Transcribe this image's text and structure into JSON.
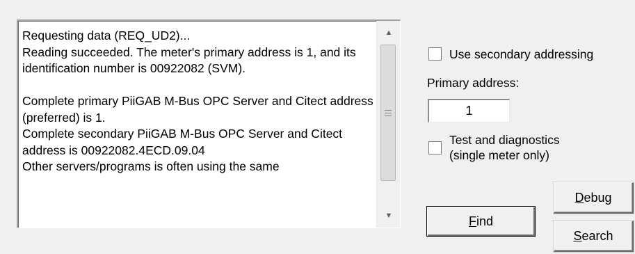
{
  "log": {
    "text": "Requesting data (REQ_UD2)...\nReading succeeded. The meter's primary address is 1, and its identification number is 00922082 (SVM).\n\nComplete primary PiiGAB M-Bus OPC Server and Citect address (preferred) is 1.\nComplete secondary PiiGAB M-Bus OPC Server and Citect address is 00922082.4ECD.09.04\nOther servers/programs is often using the same"
  },
  "options": {
    "use_secondary_label": "Use secondary addressing",
    "primary_address_label": "Primary address:",
    "primary_address_value": "1",
    "test_diag_label_line1": "Test and diagnostics",
    "test_diag_label_line2": "(single meter only)"
  },
  "buttons": {
    "find_hotkey": "F",
    "find_rest": "ind",
    "debug_hotkey": "D",
    "debug_rest": "ebug",
    "search_hotkey": "S",
    "search_rest": "earch"
  },
  "icons": {
    "scroll_up": "scroll-up-arrow-icon",
    "scroll_down": "scroll-down-arrow-icon"
  }
}
